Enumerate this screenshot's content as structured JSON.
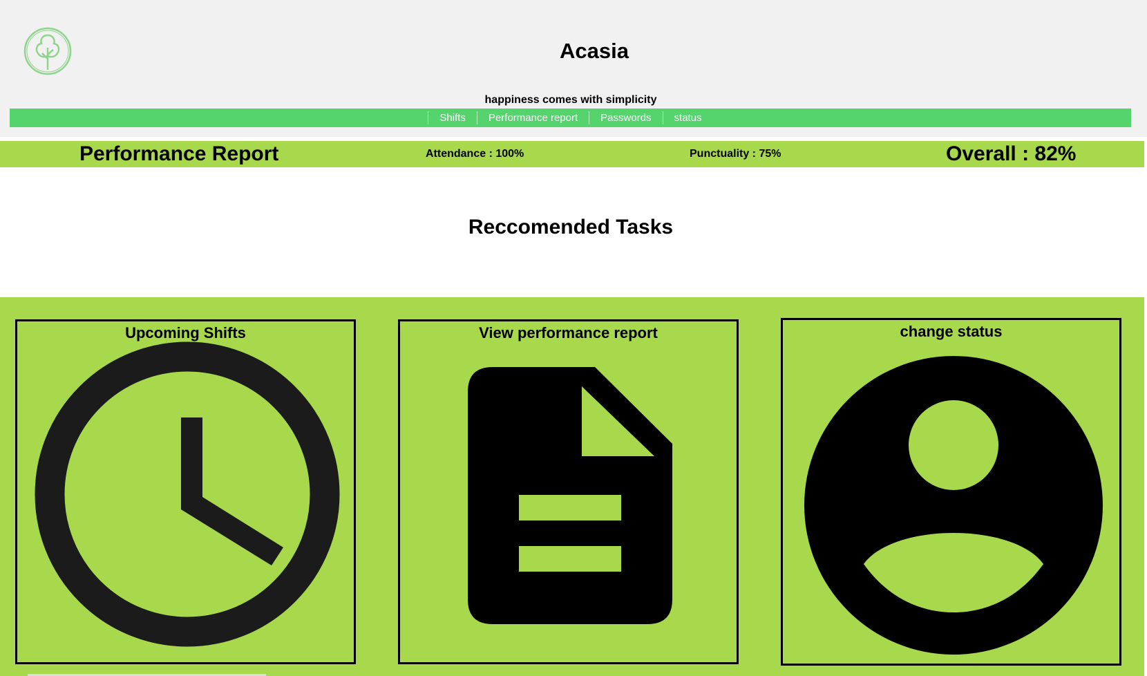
{
  "header": {
    "app_title": "Acasia",
    "tagline": "happiness comes with simplicity",
    "logo_icon": "tree-icon"
  },
  "nav": {
    "items": [
      {
        "label": "Shifts"
      },
      {
        "label": "Performance report"
      },
      {
        "label": "Passwords"
      },
      {
        "label": "status"
      }
    ]
  },
  "report": {
    "title": "Performance Report",
    "attendance": "Attendance : 100%",
    "punctuality": "Punctuality : 75%",
    "overall": "Overall : 82%"
  },
  "tasks": {
    "heading": "Reccomended Tasks",
    "cards": [
      {
        "title": "Upcoming Shifts",
        "icon": "clock-icon"
      },
      {
        "title": "View performance report",
        "icon": "document-icon"
      },
      {
        "title": "change status",
        "icon": "account-circle-icon"
      }
    ]
  },
  "colors": {
    "header_bg": "#f1f1f1",
    "nav_bg": "#55d46e",
    "accent_green": "#a8d84b",
    "logo_green": "#8fd48c"
  }
}
